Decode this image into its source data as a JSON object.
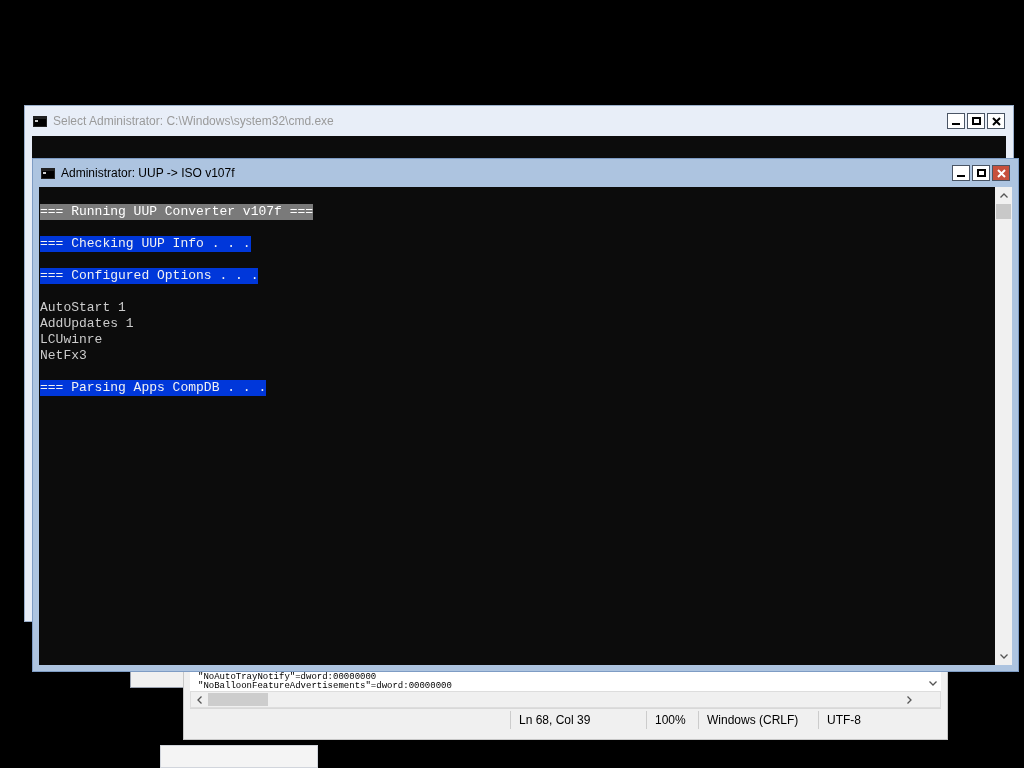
{
  "back_window": {
    "title": "Select Administrator: C:\\Windows\\system32\\cmd.exe",
    "active": false
  },
  "front_window": {
    "title": "Administrator:  UUP -> ISO v107f",
    "active": true,
    "lines": [
      {
        "kind": "gray",
        "text": "=== Running UUP Converter v107f ==="
      },
      {
        "kind": "blank"
      },
      {
        "kind": "blue",
        "text": "=== Checking UUP Info . . ."
      },
      {
        "kind": "blank"
      },
      {
        "kind": "blue",
        "text": "=== Configured Options . . ."
      },
      {
        "kind": "blank"
      },
      {
        "kind": "plain",
        "text": "AutoStart 1"
      },
      {
        "kind": "plain",
        "text": "AddUpdates 1"
      },
      {
        "kind": "plain",
        "text": "LCUwinre"
      },
      {
        "kind": "plain",
        "text": "NetFx3"
      },
      {
        "kind": "blank"
      },
      {
        "kind": "blue",
        "text": "=== Parsing Apps CompDB . . ."
      }
    ]
  },
  "notepad": {
    "lines": [
      "\"NoAutoTrayNotify\"=dword:00000000",
      "\"NoBalloonFeatureAdvertisements\"=dword:00000000"
    ],
    "status": [
      "Ln 68, Col 39",
      "100%",
      "Windows (CRLF)",
      "UTF-8"
    ]
  }
}
